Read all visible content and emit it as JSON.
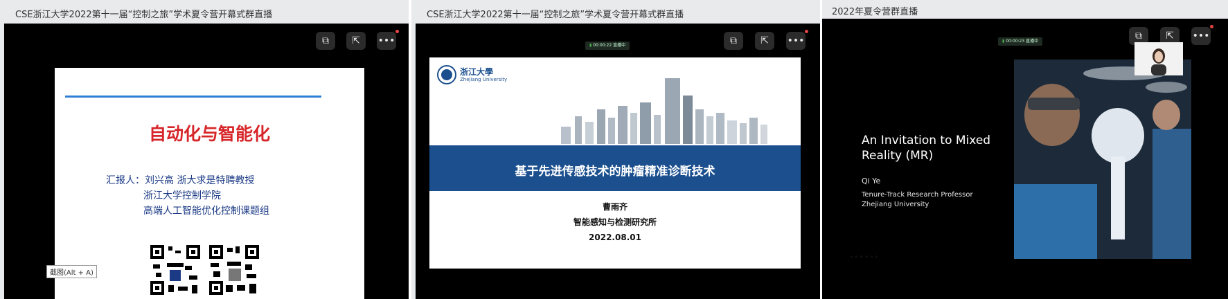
{
  "panels": [
    {
      "title": "CSE浙江大学2022第十一届“控制之旅”学术夏令营开幕式群直播",
      "slide": {
        "heading": "自动化与智能化",
        "reporter_line": "汇报人：刘兴高  浙大求是特聘教授",
        "affiliation_line1": "浙江大学控制学院",
        "affiliation_line2": "高端人工智能优化控制课题组"
      },
      "tooltip": "截图(Alt + A)"
    },
    {
      "title": "CSE浙江大学2022第十一届“控制之旅”学术夏令营开幕式群直播",
      "status": "00:00:22 直播中",
      "slide": {
        "logo_cn": "浙江大學",
        "logo_en": "Zhejiang University",
        "band_title": "基于先进传感技术的肿瘤精准诊断技术",
        "author": "曹雨齐",
        "institute": "智能感知与检测研究所",
        "date": "2022.08.01"
      }
    },
    {
      "title": "2022年夏令营群直播",
      "status": "00:00:23 直播中",
      "slide": {
        "talk_title": "An Invitation to Mixed Reality (MR)",
        "speaker": "Qi Ye",
        "position": "Tenure-Track Research Professor",
        "affiliation": "Zhejiang University"
      }
    }
  ],
  "icons": {
    "share_screen": "share-screen-icon",
    "popout": "popout-icon",
    "more": "more-icon"
  },
  "colors": {
    "slide_heading_red": "#d7262a",
    "slide_text_blue": "#1b3a86",
    "band_blue": "#1b4f8e",
    "notification_red": "#e84545"
  }
}
